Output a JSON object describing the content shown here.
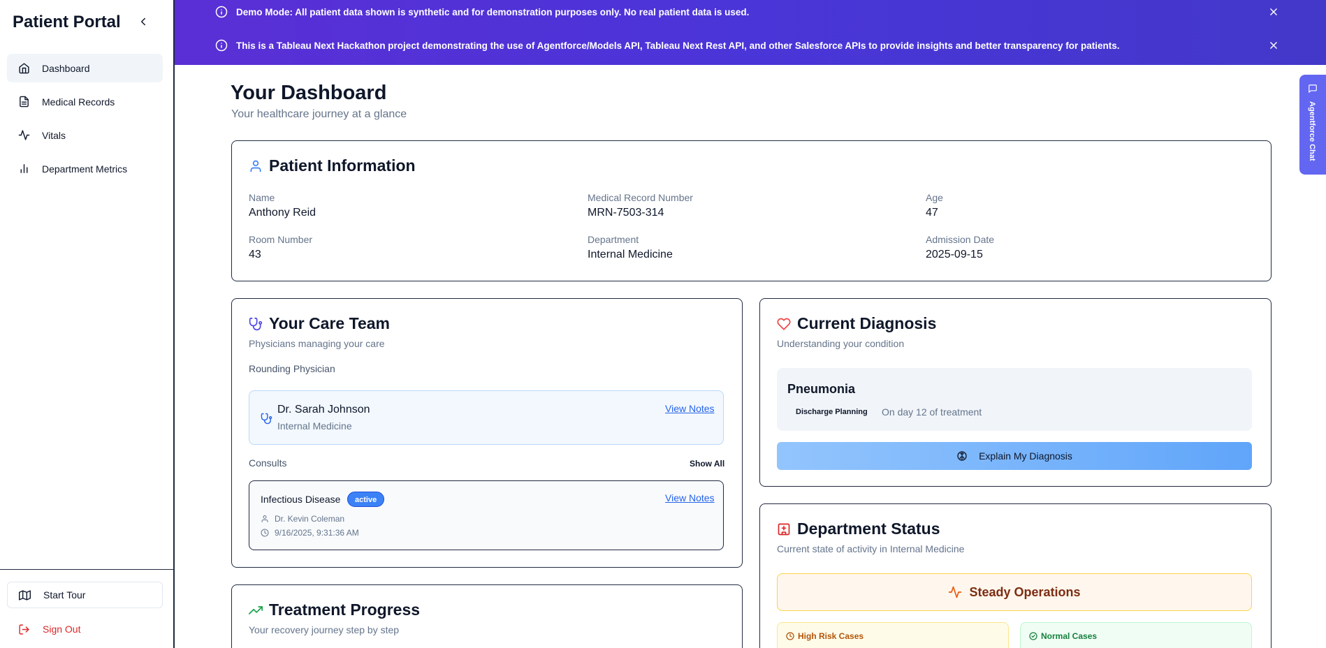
{
  "sidebar": {
    "brand": "Patient Portal",
    "items": [
      {
        "label": "Dashboard",
        "icon": "home-icon",
        "active": true
      },
      {
        "label": "Medical Records",
        "icon": "file-icon",
        "active": false
      },
      {
        "label": "Vitals",
        "icon": "activity-icon",
        "active": false
      },
      {
        "label": "Department Metrics",
        "icon": "bar-chart-icon",
        "active": false
      }
    ],
    "start_tour": "Start Tour",
    "sign_out": "Sign Out"
  },
  "banner": {
    "demo_bold": "Demo Mode:",
    "demo_text": " All patient data shown is synthetic and for demonstration purposes only. No real patient data is used.",
    "hackathon_text": "This is a Tableau Next Hackathon project demonstrating the use of Agentforce/Models API, Tableau Next Rest API, and other Salesforce APIs to provide insights and better transparency for patients."
  },
  "header": {
    "title": "Your Dashboard",
    "subtitle": "Your healthcare journey at a glance"
  },
  "patient_info": {
    "title": "Patient Information",
    "name_label": "Name",
    "name": "Anthony Reid",
    "mrn_label": "Medical Record Number",
    "mrn": "MRN-7503-314",
    "age_label": "Age",
    "age": "47",
    "room_label": "Room Number",
    "room": "43",
    "dept_label": "Department",
    "dept": "Internal Medicine",
    "admission_label": "Admission Date",
    "admission": "2025-09-15"
  },
  "care_team": {
    "title": "Your Care Team",
    "subtitle": "Physicians managing your care",
    "rounding_label": "Rounding Physician",
    "physician_name": "Dr. Sarah Johnson",
    "physician_dept": "Internal Medicine",
    "view_notes": "View Notes",
    "consults_label": "Consults",
    "show_all": "Show All",
    "consult": {
      "title": "Infectious Disease",
      "status": "active",
      "doctor": "Dr. Kevin Coleman",
      "time": "9/16/2025, 9:31:36 AM",
      "view_notes": "View Notes"
    }
  },
  "diagnosis": {
    "title": "Current Diagnosis",
    "subtitle": "Understanding your condition",
    "name": "Pneumonia",
    "tag": "Discharge Planning",
    "day_text": "On day 12 of treatment",
    "explain_button": "Explain My Diagnosis"
  },
  "treatment": {
    "title": "Treatment Progress",
    "subtitle": "Your recovery journey step by step"
  },
  "department_status": {
    "title": "Department Status",
    "subtitle": "Current state of activity in Internal Medicine",
    "status": "Steady Operations",
    "high_risk_label": "High Risk Cases",
    "normal_label": "Normal Cases"
  },
  "agent_chat": {
    "label": "Agentforce Chat"
  },
  "colors": {
    "banner_start": "#5a2fd6",
    "banner_end": "#4338ca",
    "link": "#2563eb",
    "sign_out": "#dc2626",
    "agent_tab": "#6366f1"
  }
}
